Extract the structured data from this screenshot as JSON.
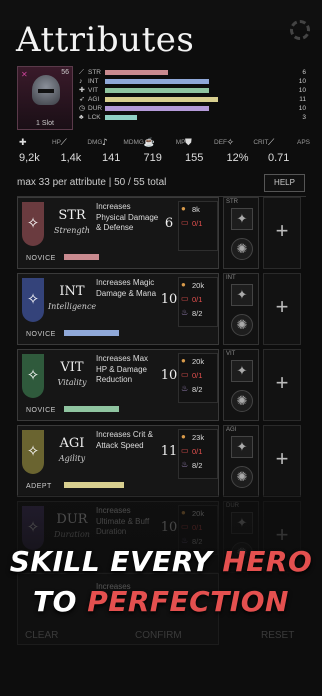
{
  "title": "Attributes",
  "hero": {
    "level": "56",
    "slot": "1 Slot",
    "stats": [
      {
        "icon": "str-icon",
        "glyph": "⟋",
        "name": "STR",
        "value": "6",
        "fill": 0.35,
        "color": "#c98a8f"
      },
      {
        "icon": "int-icon",
        "glyph": "♪",
        "name": "INT",
        "value": "10",
        "fill": 0.58,
        "color": "#8fa8d8"
      },
      {
        "icon": "vit-icon",
        "glyph": "✚",
        "name": "VIT",
        "value": "10",
        "fill": 0.58,
        "color": "#8fc4a0"
      },
      {
        "icon": "agi-icon",
        "glyph": "➶",
        "name": "AGI",
        "value": "11",
        "fill": 0.63,
        "color": "#d8cf8f"
      },
      {
        "icon": "dur-icon",
        "glyph": "◷",
        "name": "DUR",
        "value": "10",
        "fill": 0.58,
        "color": "#b49ad8"
      },
      {
        "icon": "lck-icon",
        "glyph": "♣",
        "name": "LCK",
        "value": "3",
        "fill": 0.18,
        "color": "#8fd0c4"
      }
    ]
  },
  "derived": [
    {
      "icon": "hp-icon",
      "glyph": "✚",
      "label": "HP",
      "value": "9,2k"
    },
    {
      "icon": "dmg-icon",
      "glyph": "⟋",
      "label": "DMG",
      "value": "1,4k"
    },
    {
      "icon": "mdmg-icon",
      "glyph": "♪",
      "label": "MDMG",
      "value": "141"
    },
    {
      "icon": "mp-icon",
      "glyph": "☕",
      "label": "MP",
      "value": "719"
    },
    {
      "icon": "def-icon",
      "glyph": "⛊",
      "label": "DEF",
      "value": "155"
    },
    {
      "icon": "crit-icon",
      "glyph": "✧",
      "label": "CRIT",
      "value": "12%"
    },
    {
      "icon": "aps-icon",
      "glyph": "⟋",
      "label": "APS",
      "value": "0.71"
    }
  ],
  "info_text": "max 33 per attribute  |  50 / 55 total",
  "help_label": "HELP",
  "attributes": [
    {
      "code": "STR",
      "name": "Strength",
      "desc": "Increases Physical Damage & Defense",
      "points": "6",
      "costs": [
        {
          "icon": "coin-icon",
          "glyph": "●",
          "value": "8k"
        },
        {
          "icon": "book-icon",
          "glyph": "▭",
          "value": "0/1",
          "red": true
        }
      ],
      "rank": "NOVICE",
      "rank_fill": 0.35,
      "color": "#c98a8f",
      "emblem": "#6a3b3f",
      "skill_tag": "STR"
    },
    {
      "code": "INT",
      "name": "Intelligence",
      "desc": "Increases Magic Damage & Mana",
      "points": "10",
      "costs": [
        {
          "icon": "coin-icon",
          "glyph": "●",
          "value": "20k"
        },
        {
          "icon": "book-icon",
          "glyph": "▭",
          "value": "0/1",
          "red": true
        },
        {
          "icon": "potion-icon",
          "glyph": "♨",
          "value": "8/2"
        }
      ],
      "rank": "NOVICE",
      "rank_fill": 0.55,
      "color": "#8fa8d8",
      "emblem": "#34437a",
      "skill_tag": "INT"
    },
    {
      "code": "VIT",
      "name": "Vitality",
      "desc": "Increases Max HP & Damage Reduction",
      "points": "10",
      "costs": [
        {
          "icon": "coin-icon",
          "glyph": "●",
          "value": "20k"
        },
        {
          "icon": "book-icon",
          "glyph": "▭",
          "value": "0/1",
          "red": true
        },
        {
          "icon": "potion-icon",
          "glyph": "♨",
          "value": "8/2"
        }
      ],
      "rank": "NOVICE",
      "rank_fill": 0.55,
      "color": "#8fc4a0",
      "emblem": "#2f5a3c",
      "skill_tag": "VIT"
    },
    {
      "code": "AGI",
      "name": "Agility",
      "desc": "Increases Crit & Attack Speed",
      "points": "11",
      "costs": [
        {
          "icon": "coin-icon",
          "glyph": "●",
          "value": "23k"
        },
        {
          "icon": "book-icon",
          "glyph": "▭",
          "value": "0/1",
          "red": true
        },
        {
          "icon": "potion-icon",
          "glyph": "♨",
          "value": "8/2"
        }
      ],
      "rank": "ADEPT",
      "rank_fill": 0.6,
      "color": "#d8cf8f",
      "emblem": "#6a6430",
      "skill_tag": "AGI"
    },
    {
      "code": "DUR",
      "name": "Duration",
      "desc": "Increases Ultimate & Buff Duration",
      "points": "10",
      "costs": [
        {
          "icon": "coin-icon",
          "glyph": "●",
          "value": "20k"
        },
        {
          "icon": "book-icon",
          "glyph": "▭",
          "value": "0/1",
          "red": true
        },
        {
          "icon": "potion-icon",
          "glyph": "♨",
          "value": "8/2"
        }
      ],
      "rank": "",
      "rank_fill": 0,
      "color": "#b49ad8",
      "emblem": "#4a3a6a",
      "skill_tag": "DUR"
    }
  ],
  "partial_desc": "Increases",
  "promo": {
    "line1_white": "SKILL EVERY ",
    "line1_red": "HERO",
    "line2_white": "TO ",
    "line2_red": "PERFECTION"
  },
  "bottom_buttons": [
    "CLEAR",
    "CONFIRM",
    "RESET"
  ]
}
